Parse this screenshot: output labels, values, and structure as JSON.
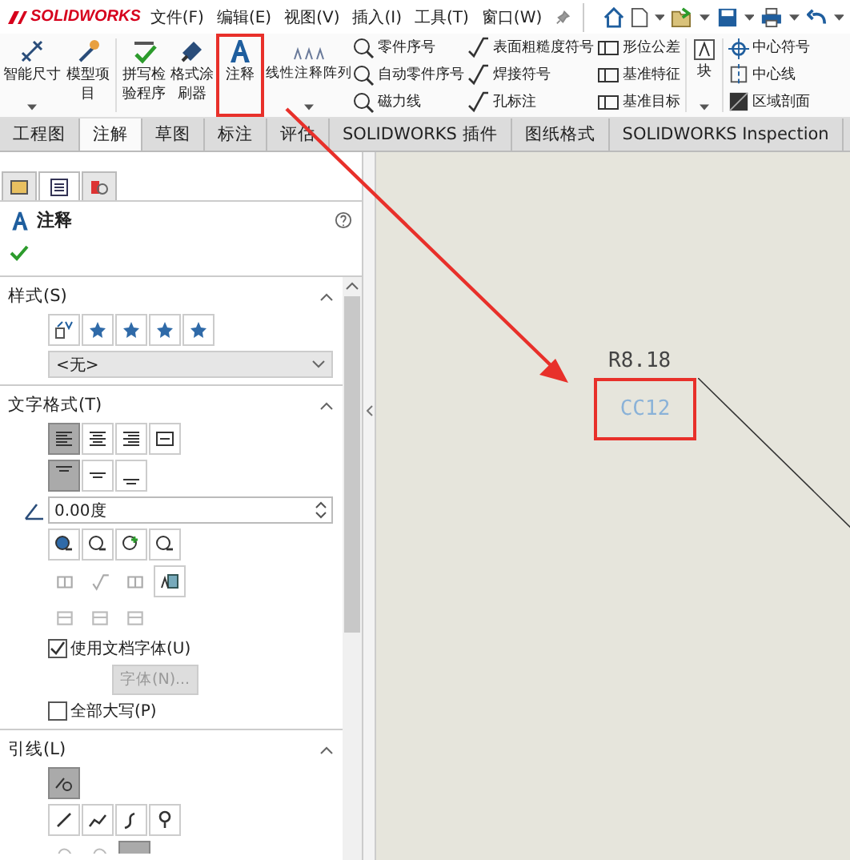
{
  "app": {
    "title": "SOLIDWORKS"
  },
  "menu": [
    "文件(F)",
    "编辑(E)",
    "视图(V)",
    "插入(I)",
    "工具(T)",
    "窗口(W)"
  ],
  "ribbon": {
    "large_buttons": [
      {
        "label": "智能尺寸",
        "dropdown": true,
        "highlighted": false
      },
      {
        "label": "模型项目",
        "dropdown": false,
        "highlighted": false
      },
      {
        "label": "拼写检验程序",
        "dropdown": false,
        "highlighted": false
      },
      {
        "label": "格式涂刷器",
        "dropdown": false,
        "highlighted": false
      },
      {
        "label": "注释",
        "dropdown": false,
        "highlighted": true
      },
      {
        "label": "线性注释阵列",
        "dropdown": true,
        "highlighted": false
      }
    ],
    "small_columns": [
      [
        "零件序号",
        "自动零件序号",
        "磁力线"
      ],
      [
        "表面粗糙度符号",
        "焊接符号",
        "孔标注"
      ],
      [
        "形位公差",
        "基准特征",
        "基准目标"
      ]
    ],
    "block_button": {
      "label": "块",
      "dropdown": true
    },
    "last_column": [
      "中心符号",
      "中心线",
      "区域剖面"
    ]
  },
  "tabs": [
    {
      "label": "工程图",
      "selected": false
    },
    {
      "label": "注解",
      "selected": true
    },
    {
      "label": "草图",
      "selected": false
    },
    {
      "label": "标注",
      "selected": false
    },
    {
      "label": "评估",
      "selected": false
    },
    {
      "label": "SOLIDWORKS 插件",
      "selected": false
    },
    {
      "label": "图纸格式",
      "selected": false
    },
    {
      "label": "SOLIDWORKS Inspection",
      "selected": false
    }
  ],
  "panel": {
    "tabs": [
      {
        "selected": false
      },
      {
        "selected": true
      },
      {
        "selected": false
      }
    ],
    "title": "注释",
    "sections": [
      {
        "kind": "style",
        "title": "样式(S)",
        "expanded": true,
        "dropdown": "<无>"
      },
      {
        "kind": "text_format",
        "title": "文字格式(T)",
        "expanded": true,
        "angle": "0.00度",
        "use_doc_font": {
          "label": "使用文档字体(U)",
          "checked": true
        },
        "font_button": {
          "label": "字体(N)...",
          "disabled": true
        },
        "all_caps": {
          "label": "全部大写(P)",
          "checked": false
        }
      },
      {
        "kind": "leader",
        "title": "引线(L)",
        "expanded": true
      }
    ]
  },
  "canvas": {
    "dimension": "R8.18",
    "note": {
      "text": "CC12",
      "highlighted": true
    },
    "callout_arrow": true
  }
}
